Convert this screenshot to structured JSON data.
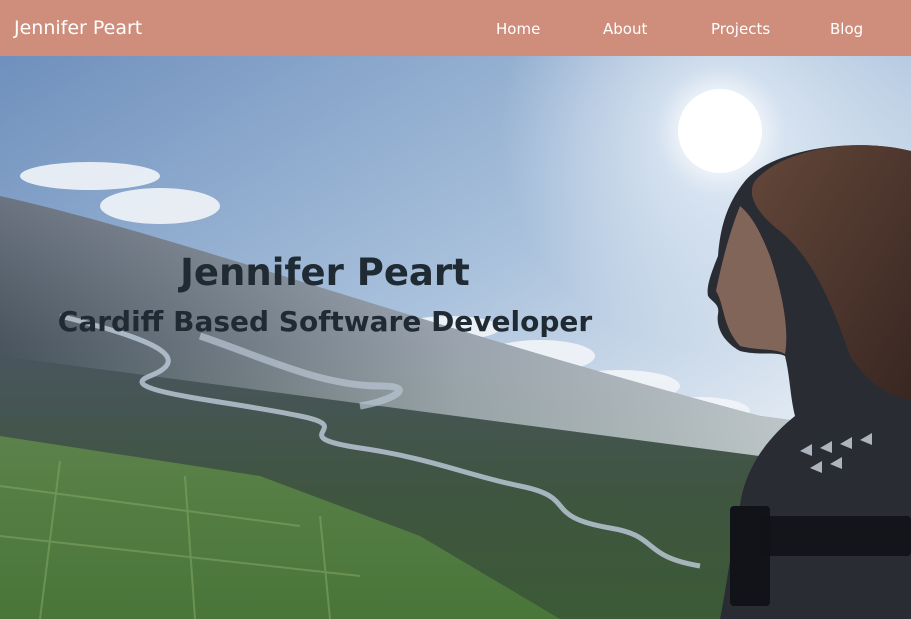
{
  "navbar": {
    "brand": "Jennifer Peart",
    "links": [
      "Home",
      "About",
      "Projects",
      "Blog"
    ],
    "background_color": "#ce8e7b"
  },
  "hero": {
    "title": "Jennifer Peart",
    "subtitle": "Cardiff Based Software Developer",
    "text_color": "#1f2a33"
  }
}
